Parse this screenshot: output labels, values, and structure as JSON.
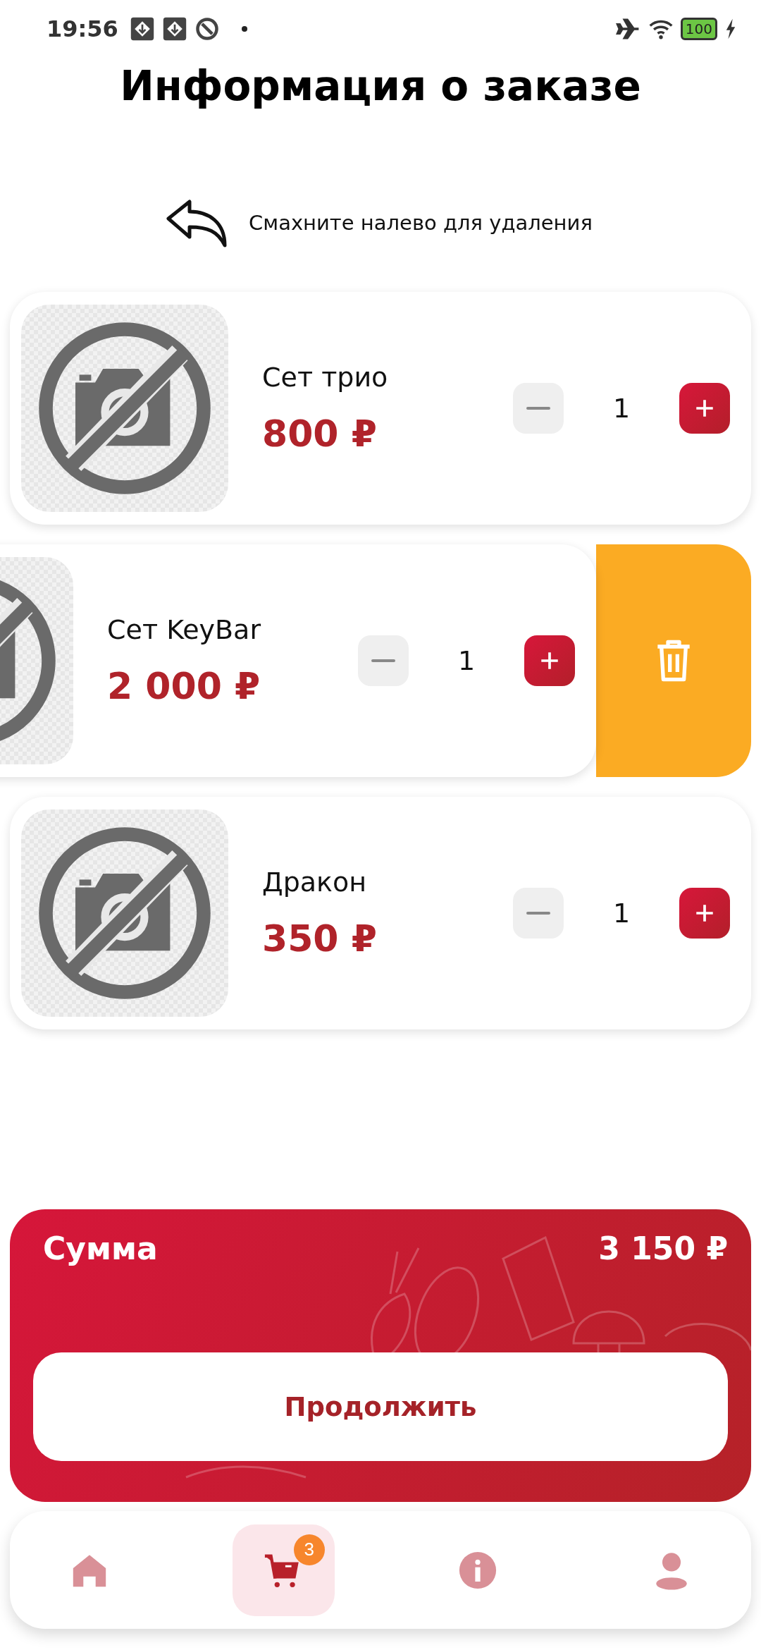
{
  "status_bar": {
    "time": "19:56",
    "battery": "100"
  },
  "title": "Информация о заказе",
  "swipe_hint": "Смахните налево для удаления",
  "items": [
    {
      "name": "Сет трио",
      "price": "800 ₽",
      "quantity": "1",
      "swiped": false
    },
    {
      "name": "Сет KeyBar",
      "price": "2 000 ₽",
      "quantity": "1",
      "swiped": true
    },
    {
      "name": "Дракон",
      "price": "350 ₽",
      "quantity": "1",
      "swiped": false
    }
  ],
  "total": {
    "label": "Сумма",
    "value": "3 150 ₽"
  },
  "continue_button": "Продолжить",
  "nav": [
    {
      "kind": "home",
      "selected": false
    },
    {
      "kind": "cart",
      "selected": true,
      "badge": "3"
    },
    {
      "kind": "info",
      "selected": false
    },
    {
      "kind": "profile",
      "selected": false
    }
  ]
}
